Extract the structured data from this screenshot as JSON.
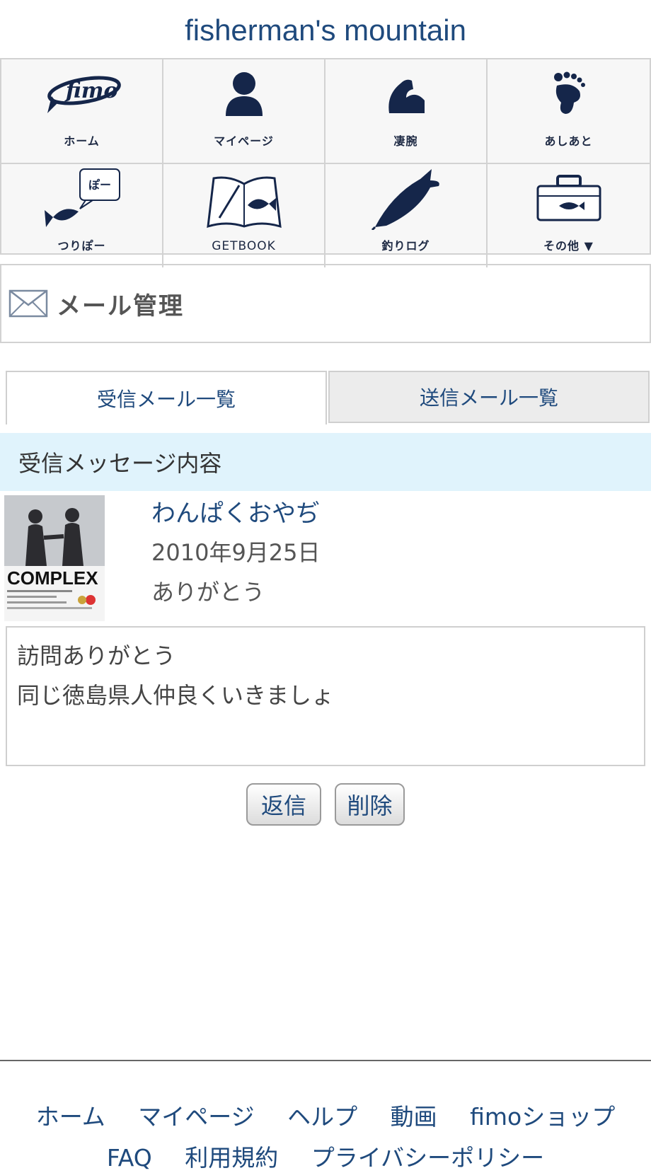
{
  "site": {
    "title": "fisherman's mountain"
  },
  "nav": {
    "items": [
      {
        "label": "ホーム",
        "icon": "fimo-logo-icon"
      },
      {
        "label": "マイページ",
        "icon": "person-icon"
      },
      {
        "label": "凄腕",
        "icon": "arm-icon"
      },
      {
        "label": "あしあと",
        "icon": "footprint-icon"
      },
      {
        "label": "つりぽー",
        "icon": "fish-speech-icon",
        "bubble": "ぽー"
      },
      {
        "label": "GETBOOK",
        "icon": "book-icon"
      },
      {
        "label": "釣りログ",
        "icon": "fish-pen-icon"
      },
      {
        "label": "その他 ▼",
        "icon": "tackle-box-icon"
      }
    ]
  },
  "section": {
    "title": "メール管理",
    "icon": "envelope-icon"
  },
  "tabs": [
    {
      "label": "受信メール一覧",
      "active": true
    },
    {
      "label": "送信メール一覧",
      "active": false
    }
  ],
  "message": {
    "header": "受信メッセージ内容",
    "sender": "わんぱくおやぢ",
    "date": "2010年9月25日",
    "subject": "ありがとう",
    "body_lines": [
      "訪問ありがとう",
      "同じ徳島県人仲良くいきましょ"
    ],
    "avatar_text": "COMPLEX"
  },
  "buttons": {
    "reply": "返信",
    "delete": "削除"
  },
  "footer": {
    "links_row1": [
      "ホーム",
      "マイページ",
      "ヘルプ",
      "動画",
      "fimoショップ"
    ],
    "links_row2": [
      "FAQ",
      "利用規約",
      "プライバシーポリシー"
    ]
  },
  "colors": {
    "link": "#1f4a7d",
    "icon": "#15264a",
    "header_bg": "#e0f3fc"
  }
}
